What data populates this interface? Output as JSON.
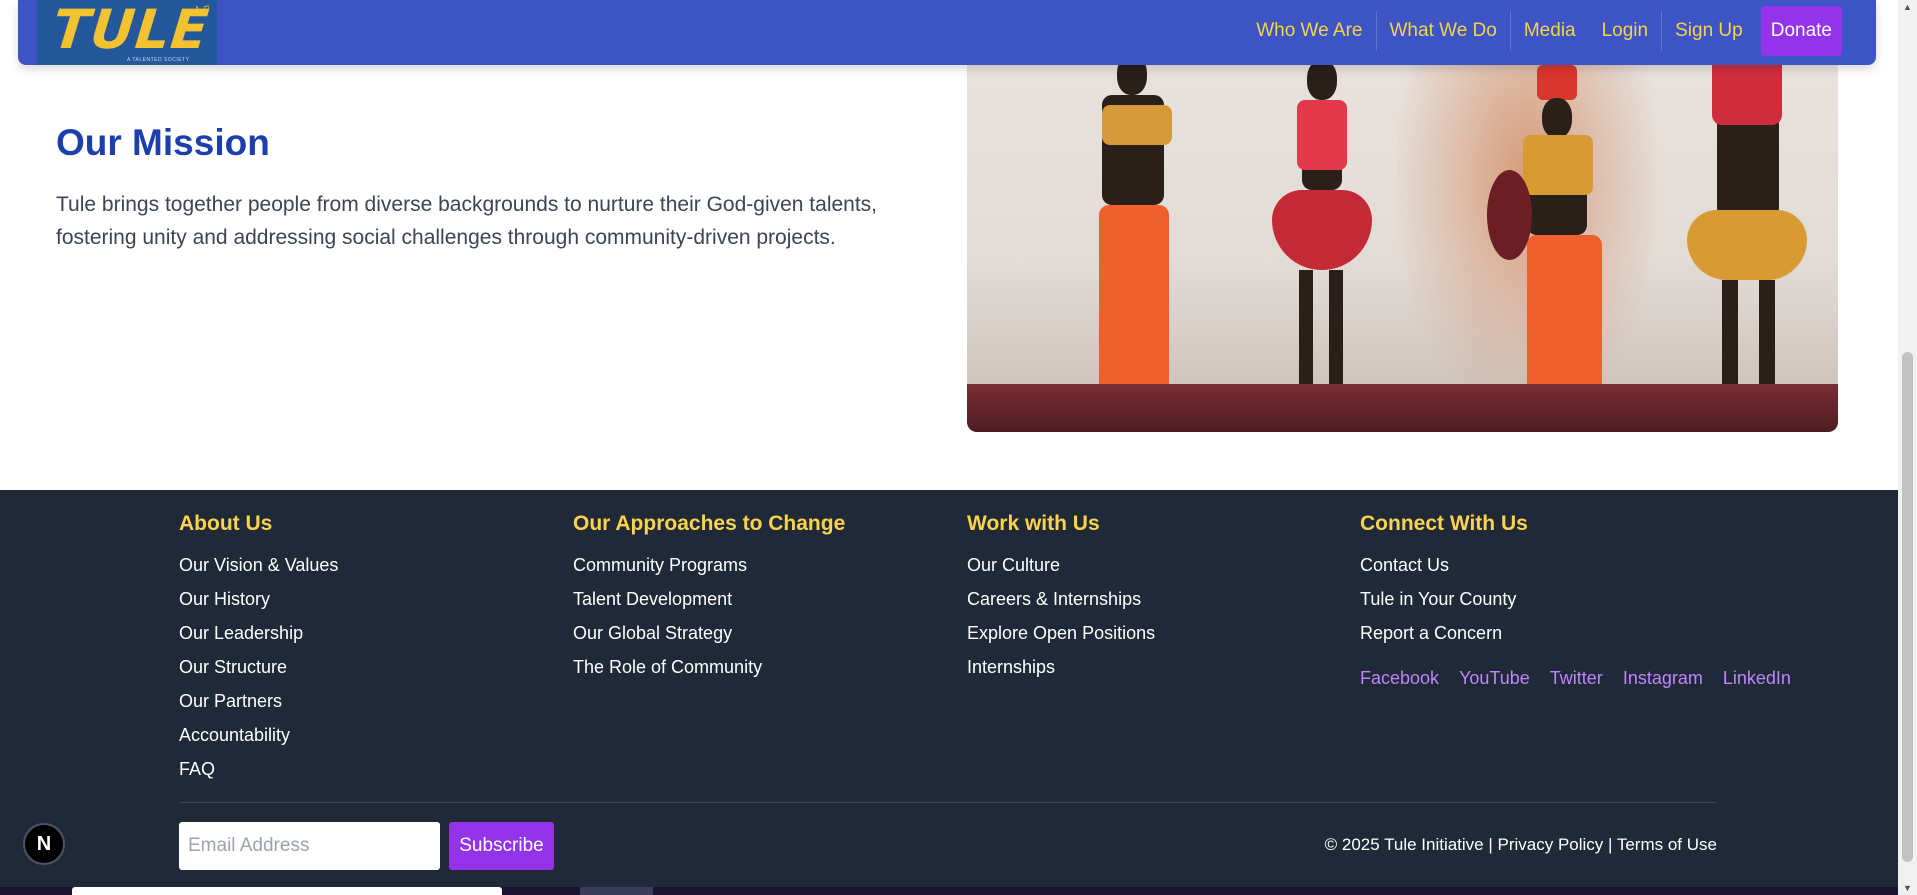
{
  "nav": {
    "logo_text": "TULE",
    "logo_tagline": "A TALENTED SOCIETY",
    "links": [
      "Who We Are",
      "What We Do",
      "Media",
      "Login",
      "Sign Up"
    ],
    "donate": "Donate"
  },
  "mission": {
    "title": "Our Mission",
    "text": "Tule brings together people from diverse backgrounds to nurture their God-given talents, fostering unity and addressing social challenges through community-driven projects."
  },
  "footer": {
    "columns": [
      {
        "title": "About Us",
        "links": [
          "Our Vision & Values",
          "Our History",
          "Our Leadership",
          "Our Structure",
          "Our Partners",
          "Accountability",
          "FAQ"
        ]
      },
      {
        "title": "Our Approaches to Change",
        "links": [
          "Community Programs",
          "Talent Development",
          "Our Global Strategy",
          "The Role of Community"
        ]
      },
      {
        "title": "Work with Us",
        "links": [
          "Our Culture",
          "Careers & Internships",
          "Explore Open Positions",
          "Internships"
        ]
      },
      {
        "title": "Connect With Us",
        "links": [
          "Contact Us",
          "Tule in Your County",
          "Report a Concern"
        ]
      }
    ],
    "social": [
      "Facebook",
      "YouTube",
      "Twitter",
      "Instagram",
      "LinkedIn"
    ],
    "email_placeholder": "Email Address",
    "subscribe": "Subscribe",
    "copyright": "© 2025 Tule Initiative | Privacy Policy | Terms of Use"
  },
  "badge": {
    "letter": "N"
  },
  "colors": {
    "nav_bg": "#3d55c4",
    "nav_link": "#f5d34a",
    "accent_purple": "#9333ea",
    "mission_title": "#1d3fae",
    "footer_bg": "#1f2937",
    "footer_heading": "#fcd34d",
    "social_link": "#c084fc"
  }
}
